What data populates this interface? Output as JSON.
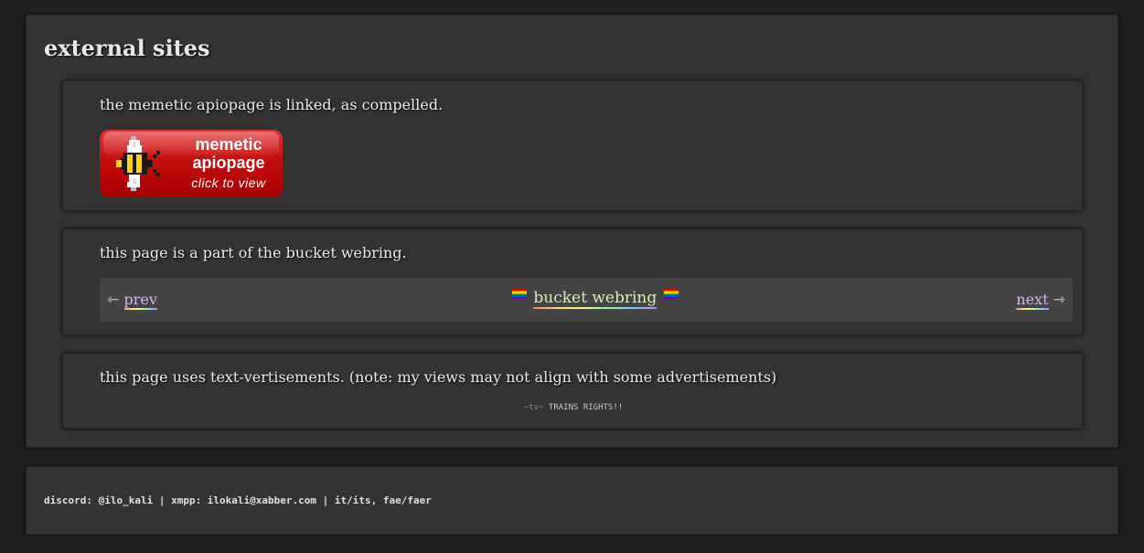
{
  "external_sites": {
    "heading": "external sites",
    "apiopage": {
      "text": "the memetic apiopage is linked, as compelled.",
      "button": {
        "line1": "memetic",
        "line2": "apiopage",
        "line3": "click to view",
        "icon": "bee-icon",
        "color": "#c40e0e"
      }
    },
    "webring": {
      "text": "this page is a part of the bucket webring.",
      "prev_arrow": "⇽",
      "prev_label": "prev",
      "center_label": "bucket webring",
      "next_label": "next",
      "next_arrow": "⇾",
      "flag_icon": "pride-flag-icon"
    },
    "textvertisement": {
      "text": "this page uses text-vertisements. (note: my views may not align with some advertisements)",
      "prefix": "~tv~",
      "ad": "TRAINS RIGHTS!!"
    }
  },
  "footer": {
    "text": "discord: @ilo_kali | xmpp: ilokali@xabber.com | it/its, fae/faer"
  }
}
